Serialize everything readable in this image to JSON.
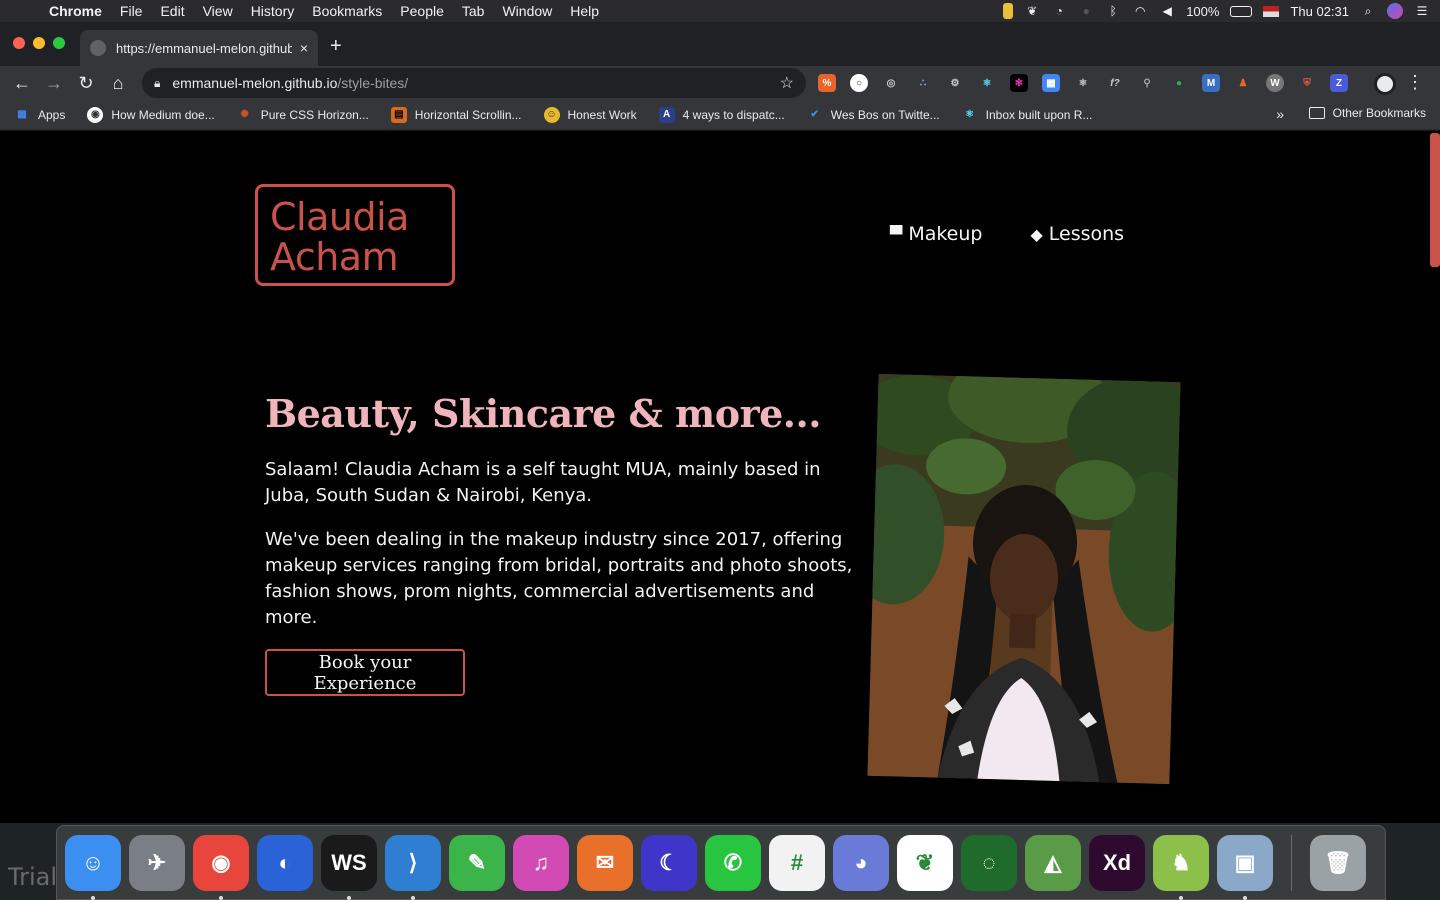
{
  "menubar": {
    "app": "Chrome",
    "items": [
      "File",
      "Edit",
      "View",
      "History",
      "Bookmarks",
      "People",
      "Tab",
      "Window",
      "Help"
    ],
    "battery": "100%",
    "clock": "Thu 02:31"
  },
  "tab": {
    "title": "https://emmanuel-melon.github.io/style-bites/",
    "close": "×",
    "new_tab": "+"
  },
  "omnibox": {
    "host": "emmanuel-melon.github.io",
    "path": "/style-bites/"
  },
  "bookmarks": {
    "items": [
      {
        "label": "Apps",
        "icon": "apps-grid-icon",
        "color": "#4285f4"
      },
      {
        "label": "How Medium doe...",
        "icon": "medium-icon",
        "color": "#ffffff"
      },
      {
        "label": "Pure CSS Horizon...",
        "icon": "codepen-icon",
        "color": "#c0562a"
      },
      {
        "label": "Horizontal Scrollin...",
        "icon": "blog-icon",
        "color": "#d96a1e"
      },
      {
        "label": "Honest Work",
        "icon": "smile-icon",
        "color": "#e8b72b"
      },
      {
        "label": "4 ways to dispatc...",
        "icon": "a-icon",
        "color": "#4a7bff"
      },
      {
        "label": "Wes Bos on Twitte...",
        "icon": "twitter-icon",
        "color": "#1da1f2"
      },
      {
        "label": "Inbox built upon R...",
        "icon": "react-icon",
        "color": "#61dafb"
      }
    ],
    "more": "»",
    "other": "Other Bookmarks"
  },
  "site": {
    "logo_line1": "Claudia",
    "logo_line2": "Acham",
    "nav": [
      {
        "label": "Makeup",
        "icon": "brush-icon"
      },
      {
        "label": "Lessons",
        "icon": "graduation-cap-icon"
      }
    ],
    "hero_title": "Beauty, Skincare & more...",
    "intro": "Salaam! Claudia Acham is a self taught MUA, mainly based in Juba, South Sudan & Nairobi, Kenya.",
    "details": "We've been dealing in the makeup industry since 2017, offering makeup services ranging from bridal, portraits and photo shoots, fashion shows, prom nights, commercial advertisements and more.",
    "cta": "Book your Experience",
    "accent": "#c9524a",
    "title_color": "#f0b4bb"
  },
  "dock": {
    "trial": "Trial",
    "apps": [
      {
        "name": "finder-icon",
        "glyph": "☺",
        "bg": "#3b8ff0",
        "running": true
      },
      {
        "name": "launchpad-icon",
        "glyph": "✈",
        "bg": "#7a7f86",
        "running": false
      },
      {
        "name": "chrome-icon",
        "glyph": "◉",
        "bg": "#e8453c",
        "running": true
      },
      {
        "name": "firefox-icon",
        "glyph": "◐",
        "bg": "#2a62d8",
        "running": false
      },
      {
        "name": "webstorm-icon",
        "glyph": "WS",
        "bg": "#1a1a1a",
        "running": true
      },
      {
        "name": "vscode-icon",
        "glyph": "⟩",
        "bg": "#2e7fd1",
        "running": true
      },
      {
        "name": "evernote-icon",
        "glyph": "✎",
        "bg": "#3bb54a",
        "running": false
      },
      {
        "name": "itunes-icon",
        "glyph": "♫",
        "bg": "#d24bb5",
        "running": false
      },
      {
        "name": "postman-icon",
        "glyph": "✉",
        "bg": "#e8702a",
        "running": false
      },
      {
        "name": "moon-app-icon",
        "glyph": "☾",
        "bg": "#3f35c9",
        "running": false
      },
      {
        "name": "whatsapp-icon",
        "glyph": "✆",
        "bg": "#28c541",
        "running": false
      },
      {
        "name": "slack-icon",
        "glyph": "#",
        "bg": "#f2f2f2",
        "running": false
      },
      {
        "name": "discord-icon",
        "glyph": "◕",
        "bg": "#6a7ad8",
        "running": false
      },
      {
        "name": "mongodb-icon",
        "glyph": "❦",
        "bg": "#ffffff",
        "running": false
      },
      {
        "name": "loading-app-icon",
        "glyph": "◌",
        "bg": "#1f6b2c",
        "running": false
      },
      {
        "name": "android-studio-icon",
        "glyph": "◭",
        "bg": "#5a9b47",
        "running": false
      },
      {
        "name": "adobe-xd-icon",
        "glyph": "Xd",
        "bg": "#2e0a2e",
        "running": false
      },
      {
        "name": "android-file-transfer-icon",
        "glyph": "♞",
        "bg": "#8cc04a",
        "running": true
      },
      {
        "name": "preview-icon",
        "glyph": "▣",
        "bg": "#8aa9c9",
        "running": true
      }
    ],
    "trash": {
      "name": "trash-icon",
      "glyph": "🗑",
      "bg": "#9aa2a6"
    }
  }
}
